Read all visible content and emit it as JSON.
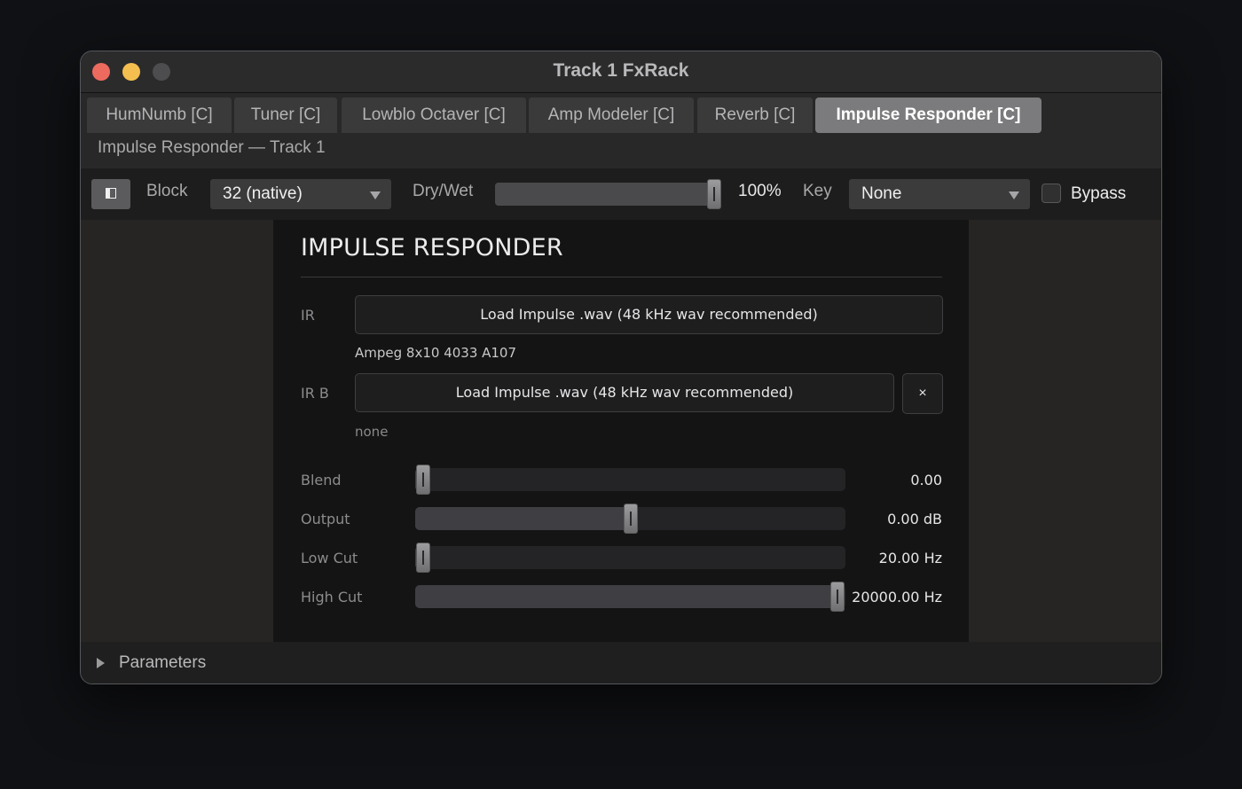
{
  "window": {
    "title": "Track 1 FxRack"
  },
  "tabs": [
    {
      "label": "HumNumb [C]",
      "active": false
    },
    {
      "label": "Tuner [C]",
      "active": false
    },
    {
      "label": "Lowblo Octaver [C]",
      "active": false
    },
    {
      "label": "Amp Modeler [C]",
      "active": false
    },
    {
      "label": "Reverb [C]",
      "active": false
    },
    {
      "label": "Impulse Responder [C]",
      "active": true
    }
  ],
  "subtitle": "Impulse Responder — Track 1",
  "toolbar": {
    "toggle_icon": "sidebar-toggle-icon",
    "block_label": "Block",
    "block_value": "32 (native)",
    "drywet_label": "Dry/Wet",
    "drywet_fraction": 1.0,
    "drywet_value": "100%",
    "key_label": "Key",
    "key_value": "None",
    "bypass_label": "Bypass",
    "bypass_checked": false
  },
  "panel": {
    "title": "IMPULSE RESPONDER",
    "ir": {
      "label": "IR",
      "button": "Load Impulse .wav (48 kHz wav recommended)",
      "file": "Ampeg 8x10 4033 A107"
    },
    "ir_b": {
      "label": "IR B",
      "button": "Load Impulse .wav (48 kHz wav recommended)",
      "clear": "×",
      "file": "none"
    },
    "params": [
      {
        "label": "Blend",
        "value": "0.00",
        "fraction": 0.0
      },
      {
        "label": "Output",
        "value": "0.00 dB",
        "fraction": 0.5
      },
      {
        "label": "Low Cut",
        "value": "20.00 Hz",
        "fraction": 0.0
      },
      {
        "label": "High Cut",
        "value": "20000.00 Hz",
        "fraction": 1.0
      }
    ]
  },
  "footer": {
    "label": "Parameters"
  },
  "colors": {
    "close": "#ed6a5e",
    "minimize": "#f5bf4f",
    "maximize": "#4d4d4f",
    "active_tab": "#7b7b7d"
  }
}
